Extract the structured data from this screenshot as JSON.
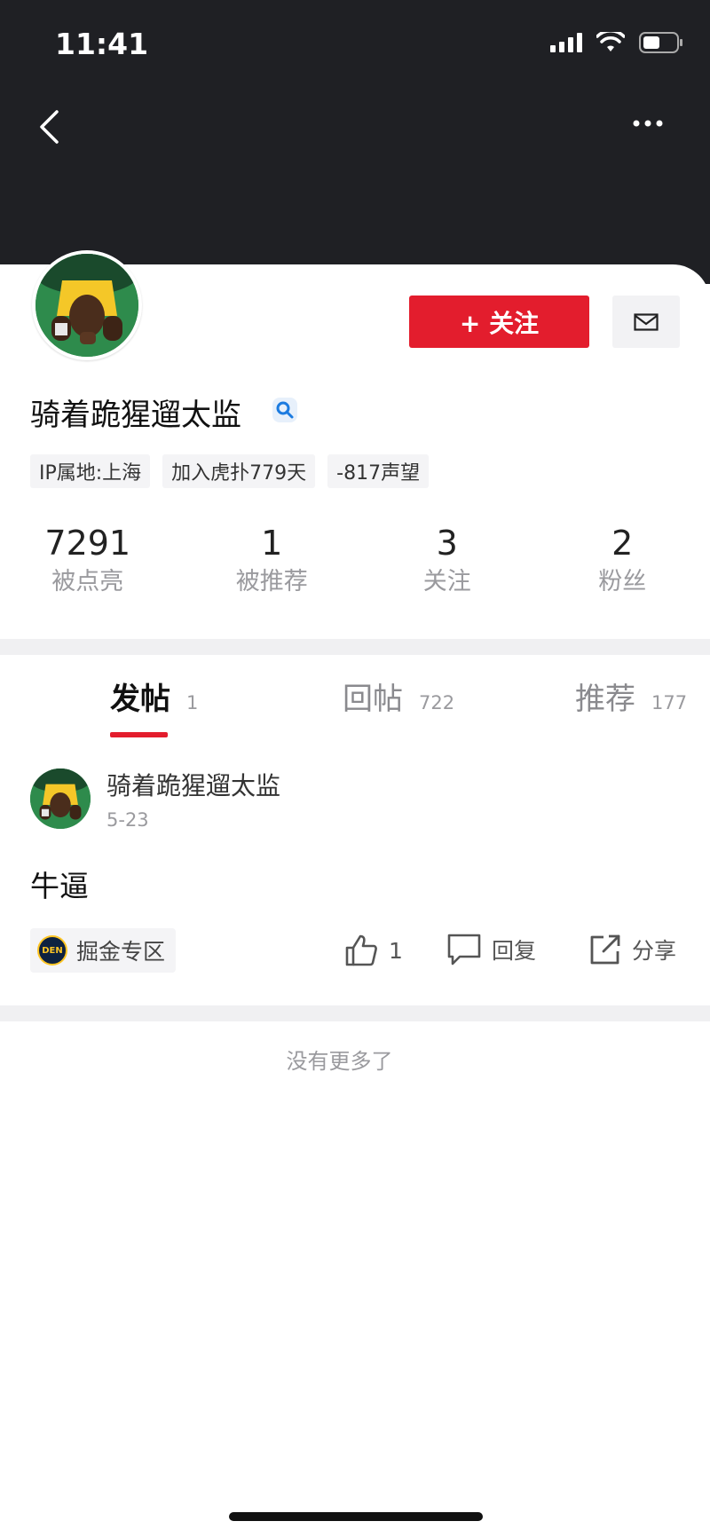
{
  "status_bar": {
    "time": "11:41"
  },
  "profile": {
    "username": "骑着跪猩遛太监",
    "follow_label": "+ 关注",
    "tags": [
      "IP属地:上海",
      "加入虎扑779天",
      "-817声望"
    ],
    "stats": [
      {
        "value": "7291",
        "label": "被点亮"
      },
      {
        "value": "1",
        "label": "被推荐"
      },
      {
        "value": "3",
        "label": "关注"
      },
      {
        "value": "2",
        "label": "粉丝"
      }
    ]
  },
  "tabs": [
    {
      "label": "发帖",
      "count": "1",
      "active": true
    },
    {
      "label": "回帖",
      "count": "722",
      "active": false
    },
    {
      "label": "推荐",
      "count": "177",
      "active": false
    }
  ],
  "post": {
    "author": "骑着跪猩遛太监",
    "date": "5-23",
    "content": "牛逼",
    "zone": {
      "label": "掘金专区",
      "logo_text": "DEN"
    },
    "like_count": "1",
    "reply_label": "回复",
    "share_label": "分享"
  },
  "footer": {
    "no_more": "没有更多了"
  },
  "colors": {
    "accent": "#e31d2d",
    "header_bg": "#1f2024"
  }
}
